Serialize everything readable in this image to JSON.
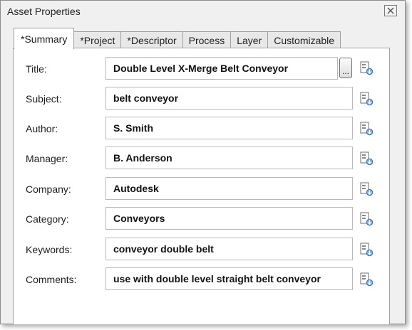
{
  "window": {
    "title": "Asset Properties"
  },
  "tabs": [
    {
      "label": "*Summary"
    },
    {
      "label": "*Project"
    },
    {
      "label": "*Descriptor"
    },
    {
      "label": "Process"
    },
    {
      "label": "Layer"
    },
    {
      "label": "Customizable"
    }
  ],
  "active_tab": "*Summary",
  "browse_button": {
    "label": "..."
  },
  "fields": [
    {
      "label": "Title:",
      "value": "Double Level X-Merge Belt Conveyor"
    },
    {
      "label": "Subject:",
      "value": "belt conveyor"
    },
    {
      "label": "Author:",
      "value": "S. Smith"
    },
    {
      "label": "Manager:",
      "value": "B. Anderson"
    },
    {
      "label": "Company:",
      "value": "Autodesk"
    },
    {
      "label": "Category:",
      "value": "Conveyors"
    },
    {
      "label": "Keywords:",
      "value": "conveyor double belt"
    },
    {
      "label": "Comments:",
      "value": "use with double level straight belt conveyor"
    }
  ]
}
